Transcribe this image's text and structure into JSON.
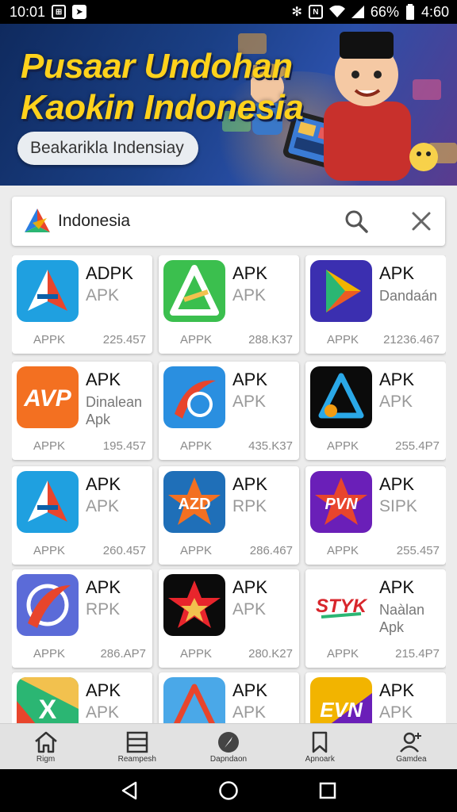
{
  "status_bar": {
    "time": "10:01",
    "battery": "66%",
    "clock_right": "4:60"
  },
  "banner": {
    "title_line1": "Pusaar Undohan",
    "title_line2": "Kaokin Indonesia",
    "button_label": "Beakarikla Indensiay"
  },
  "search": {
    "value": "Indonesia"
  },
  "apps": [
    {
      "name": "ADPK",
      "sub": "APK",
      "tag": "APPK",
      "count": "225.457",
      "icon": "triangle-a-blue"
    },
    {
      "name": "APK",
      "sub": "APK",
      "tag": "APPK",
      "count": "288.K37",
      "icon": "triangle-a-green"
    },
    {
      "name": "APK",
      "sub": "Dandaán",
      "tag": "APPK",
      "count": "21236.467",
      "icon": "play-purple"
    },
    {
      "name": "APK",
      "sub": "Dinalean Apk",
      "tag": "APPK",
      "count": "195.457",
      "icon": "avp-orange"
    },
    {
      "name": "APK",
      "sub": "APK",
      "tag": "APPK",
      "count": "435.K37",
      "icon": "swoosh-blue"
    },
    {
      "name": "APK",
      "sub": "APK",
      "tag": "APPK",
      "count": "255.4P7",
      "icon": "triangle-dark"
    },
    {
      "name": "APK",
      "sub": "APK",
      "tag": "APPK",
      "count": "260.457",
      "icon": "triangle-a-blue"
    },
    {
      "name": "APK",
      "sub": "RPK",
      "tag": "APPK",
      "count": "286.467",
      "icon": "azd-star"
    },
    {
      "name": "APK",
      "sub": "SIPK",
      "tag": "APPK",
      "count": "255.457",
      "icon": "pvn-purple"
    },
    {
      "name": "APK",
      "sub": "RPK",
      "tag": "APPK",
      "count": "286.AP7",
      "icon": "swoosh-purple"
    },
    {
      "name": "APK",
      "sub": "APK",
      "tag": "APPK",
      "count": "280.K27",
      "icon": "star-black"
    },
    {
      "name": "APK",
      "sub": "Naàlan Apk",
      "tag": "APPK",
      "count": "215.4P7",
      "icon": "styk-text"
    },
    {
      "name": "APK",
      "sub": "APK",
      "tag": "",
      "count": "",
      "icon": "x-rainbow"
    },
    {
      "name": "APK",
      "sub": "APK",
      "tag": "",
      "count": "",
      "icon": "triangle-sky"
    },
    {
      "name": "APK",
      "sub": "APK",
      "tag": "",
      "count": "",
      "icon": "evn-gold"
    }
  ],
  "bottom_nav": [
    {
      "label": "Rigm",
      "icon": "home-icon"
    },
    {
      "label": "Reampesh",
      "icon": "list-icon"
    },
    {
      "label": "Dapndaon",
      "icon": "compass-icon"
    },
    {
      "label": "Apnoark",
      "icon": "bookmark-icon"
    },
    {
      "label": "Gamdea",
      "icon": "profile-icon"
    }
  ]
}
